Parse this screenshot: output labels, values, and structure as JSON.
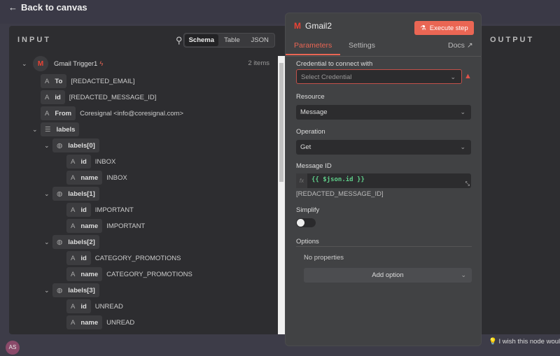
{
  "topbar": {
    "back_label": "Back to canvas"
  },
  "input": {
    "title": "INPUT",
    "view_tabs": [
      "Schema",
      "Table",
      "JSON"
    ],
    "active_view": "Schema",
    "node_name": "Gmail Trigger1",
    "item_count": "2 items",
    "rows": [
      {
        "type": "A",
        "key": "To",
        "value": "[REDACTED_EMAIL]",
        "depth": 1
      },
      {
        "type": "A",
        "key": "id",
        "value": "[REDACTED_MESSAGE_ID]",
        "depth": 1
      },
      {
        "type": "A",
        "key": "From",
        "value": "Coresignal <info@coresignal.com>",
        "depth": 1
      },
      {
        "type": "list",
        "key": "labels",
        "value": "",
        "depth": 1,
        "expand": true
      },
      {
        "type": "obj",
        "key": "labels[0]",
        "value": "",
        "depth": 2,
        "expand": true
      },
      {
        "type": "A",
        "key": "id",
        "value": "INBOX",
        "depth": 3
      },
      {
        "type": "A",
        "key": "name",
        "value": "INBOX",
        "depth": 3
      },
      {
        "type": "obj",
        "key": "labels[1]",
        "value": "",
        "depth": 2,
        "expand": true
      },
      {
        "type": "A",
        "key": "id",
        "value": "IMPORTANT",
        "depth": 3
      },
      {
        "type": "A",
        "key": "name",
        "value": "IMPORTANT",
        "depth": 3
      },
      {
        "type": "obj",
        "key": "labels[2]",
        "value": "",
        "depth": 2,
        "expand": true
      },
      {
        "type": "A",
        "key": "id",
        "value": "CATEGORY_PROMOTIONS",
        "depth": 3
      },
      {
        "type": "A",
        "key": "name",
        "value": "CATEGORY_PROMOTIONS",
        "depth": 3
      },
      {
        "type": "obj",
        "key": "labels[3]",
        "value": "",
        "depth": 2,
        "expand": true
      },
      {
        "type": "A",
        "key": "id",
        "value": "UNREAD",
        "depth": 3
      },
      {
        "type": "A",
        "key": "name",
        "value": "UNREAD",
        "depth": 3
      }
    ]
  },
  "node": {
    "title": "Gmail2",
    "execute_label": "Execute step",
    "tabs": [
      "Parameters",
      "Settings"
    ],
    "docs_label": "Docs",
    "credential_label": "Credential to connect with",
    "credential_placeholder": "Select Credential",
    "resource_label": "Resource",
    "resource_value": "Message",
    "operation_label": "Operation",
    "operation_value": "Get",
    "message_id_label": "Message ID",
    "message_id_expr": "{{ $json.id }}",
    "message_id_preview": "[REDACTED_MESSAGE_ID]",
    "simplify_label": "Simplify",
    "simplify_on": false,
    "options_label": "Options",
    "no_properties": "No properties",
    "add_option_label": "Add option"
  },
  "output": {
    "title": "OUTPUT"
  },
  "footer": {
    "hint": "I wish this node would...",
    "avatar": "AS"
  },
  "colors": {
    "accent": "#ea6654",
    "expr": "#5fcf8a"
  }
}
